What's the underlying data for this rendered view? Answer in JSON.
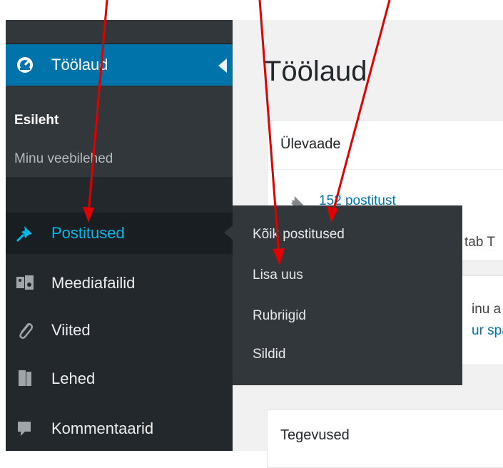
{
  "sidebar": {
    "dashboard": {
      "label": "Töölaud",
      "icon": "dashboard-gauge-icon"
    },
    "dashboard_sub": [
      "Esileht",
      "Minu veebilehed"
    ],
    "items": [
      {
        "label": "Postitused",
        "icon": "pushpin-icon"
      },
      {
        "label": "Meediafailid",
        "icon": "media-icon"
      },
      {
        "label": "Viited",
        "icon": "paperclip-link-icon"
      },
      {
        "label": "Lehed",
        "icon": "pages-icon"
      },
      {
        "label": "Kommentaarid",
        "icon": "comment-icon"
      }
    ]
  },
  "flyout": {
    "items": [
      "Kõik postitused",
      "Lisa uus",
      "Rubriigid",
      "Sildid"
    ]
  },
  "main": {
    "title": "Töölaud",
    "overview": {
      "title": "Ülevaade",
      "posts_link": "152 postitust",
      "clipped_text": "tab T",
      "clipped_text2": "inu a",
      "clipped_link": "ur spa"
    },
    "activity": {
      "title": "Tegevused"
    }
  },
  "colors": {
    "sidebar_bg": "#23282d",
    "active_bg": "#0073aa",
    "hover_text": "#00b9eb",
    "flyout_bg": "#32373c",
    "annotation_arrow": "#e00000"
  }
}
